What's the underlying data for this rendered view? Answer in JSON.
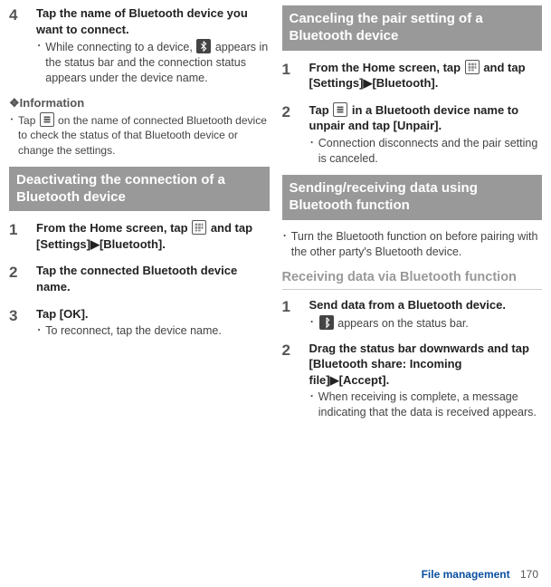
{
  "left": {
    "step4": {
      "num": "4",
      "title": "Tap the name of Bluetooth device you want to connect.",
      "bullet": "While connecting to a device, ",
      "bullet2": " appears in the status bar and the connection status appears under the device name."
    },
    "info_head": "❖Information",
    "info": {
      "pre": "Tap ",
      "post": " on the name of connected Bluetooth device to check the status of that Bluetooth device or change the settings."
    },
    "deact_title": "Deactivating the connection of a Bluetooth device",
    "d1": {
      "num": "1",
      "pre": "From the Home screen, tap ",
      "post": " and tap [Settings]▶[Bluetooth]."
    },
    "d2": {
      "num": "2",
      "title": "Tap the connected Bluetooth device name."
    },
    "d3": {
      "num": "3",
      "title": "Tap [OK].",
      "bullet": "To reconnect, tap the device name."
    }
  },
  "right": {
    "cancel_title": "Canceling the pair setting of a Bluetooth device",
    "c1": {
      "num": "1",
      "pre": "From the Home screen, tap ",
      "post": " and tap [Settings]▶[Bluetooth]."
    },
    "c2": {
      "num": "2",
      "pre": "Tap ",
      "post": " in a Bluetooth device name to unpair and tap [Unpair].",
      "bullet": "Connection disconnects and the pair setting is canceled."
    },
    "send_title": "Sending/receiving data using Bluetooth function",
    "send_bullet": "Turn the Bluetooth function on before pairing with the other party's Bluetooth device.",
    "recv_head": "Receiving data via Bluetooth function",
    "r1": {
      "num": "1",
      "title": "Send data from a Bluetooth device.",
      "bullet_post": " appears on the status bar."
    },
    "r2": {
      "num": "2",
      "title": "Drag the status bar downwards and tap [Bluetooth share: Incoming file]▶[Accept].",
      "bullet": "When receiving is complete, a message indicating that the data is received appears."
    }
  },
  "footer": {
    "section": "File management",
    "page": "170"
  }
}
